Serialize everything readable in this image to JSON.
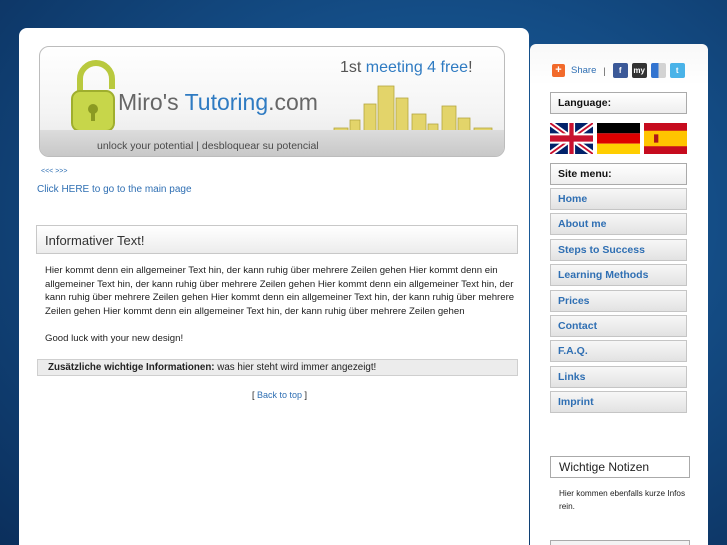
{
  "header": {
    "brand_prefix": "Miro's ",
    "brand_highlight": "Tutoring",
    "brand_suffix": ".com",
    "promo_prefix": "1st ",
    "promo_highlight": "meeting 4 free",
    "promo_suffix": "!",
    "slogan": "unlock your potential | desbloquear su potencial"
  },
  "nav": {
    "arrows": "<<< >>>",
    "main_link": "Click HERE to go to the main page"
  },
  "content": {
    "heading": "Informativer Text!",
    "paragraph": "Hier kommt denn ein allgemeiner Text hin, der kann ruhig über mehrere Zeilen gehen Hier kommt denn ein allgemeiner Text hin, der kann ruhig über mehrere Zeilen gehen Hier kommt denn ein allgemeiner Text hin, der kann ruhig über mehrere Zeilen gehen Hier kommt denn ein allgemeiner Text hin, der kann ruhig über mehrere Zeilen gehen Hier kommt denn ein allgemeiner Text hin, der kann ruhig über mehrere Zeilen gehen",
    "good_luck": "Good luck with your new design!",
    "info_label": "Zusätzliche wichtige Informationen:",
    "info_text": " was hier steht wird immer angezeigt!",
    "back_open": "[ ",
    "back_link": "Back to top",
    "back_close": " ]"
  },
  "sidebar": {
    "share_label": "Share",
    "share_sep": "|",
    "social_icons": [
      "facebook-icon",
      "myspace-icon",
      "delicious-icon",
      "twitter-icon"
    ],
    "language_heading": "Language:",
    "flags": [
      "uk-flag",
      "germany-flag",
      "spain-flag"
    ],
    "menu_heading": "Site menu:",
    "menu_items": [
      {
        "label": "Home"
      },
      {
        "label": "About me"
      },
      {
        "label": "Steps to Success"
      },
      {
        "label": "Learning Methods"
      },
      {
        "label": "Prices"
      },
      {
        "label": "Contact"
      },
      {
        "label": "F.A.Q."
      },
      {
        "label": "Links"
      },
      {
        "label": "Imprint"
      }
    ],
    "notes_heading": "Wichtige Notizen",
    "notes_text": "Hier kommen ebenfalls kurze Infos rein."
  },
  "colors": {
    "accent": "#2f7bc2",
    "link": "#2f6fb3",
    "background": "#144d86"
  }
}
